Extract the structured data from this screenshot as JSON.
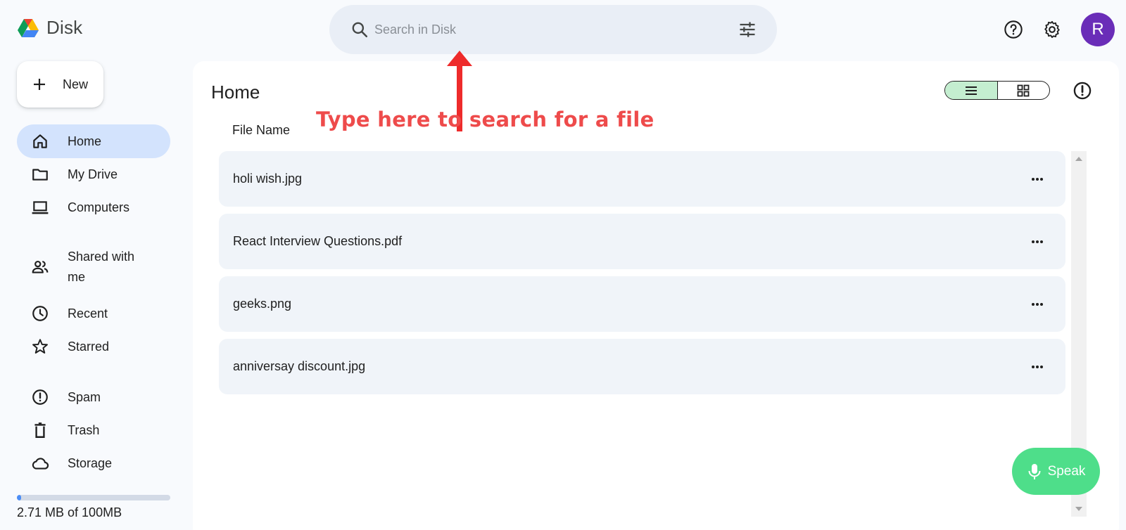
{
  "app": {
    "logo_text": "Disk",
    "logo_icon": "drive-triangle-logo"
  },
  "search": {
    "placeholder": "Search in Disk",
    "value": "",
    "icon": "search-icon",
    "filter_icon": "tune-icon"
  },
  "header": {
    "help_icon": "help-icon",
    "settings_icon": "gear-icon",
    "avatar_letter": "R",
    "avatar_color": "#6a2db8"
  },
  "sidebar": {
    "new_label": "New",
    "items": [
      {
        "label": "Home",
        "icon": "home-icon",
        "active": true
      },
      {
        "label": "My Drive",
        "icon": "folder-icon",
        "active": false
      },
      {
        "label": "Computers",
        "icon": "laptop-icon",
        "active": false
      },
      {
        "label": "Shared with me",
        "icon": "people-icon",
        "active": false
      },
      {
        "label": "Recent",
        "icon": "clock-icon",
        "active": false
      },
      {
        "label": "Starred",
        "icon": "star-icon",
        "active": false
      },
      {
        "label": "Spam",
        "icon": "spam-icon",
        "active": false
      },
      {
        "label": "Trash",
        "icon": "trash-icon",
        "active": false
      },
      {
        "label": "Storage",
        "icon": "cloud-icon",
        "active": false
      }
    ],
    "storage": {
      "text": "2.71 MB of 100MB",
      "used_fraction": 0.027
    }
  },
  "main": {
    "title": "Home",
    "column_header": "File Name",
    "view_mode": "list",
    "files": [
      {
        "name": "holi wish.jpg"
      },
      {
        "name": "React Interview Questions.pdf"
      },
      {
        "name": "geeks.png"
      },
      {
        "name": "anniversay discount.jpg"
      }
    ]
  },
  "annotation": {
    "text": "Type here to search for a file",
    "color": "#ee4b4b"
  },
  "speak": {
    "label": "Speak",
    "color": "#4ede8a"
  }
}
